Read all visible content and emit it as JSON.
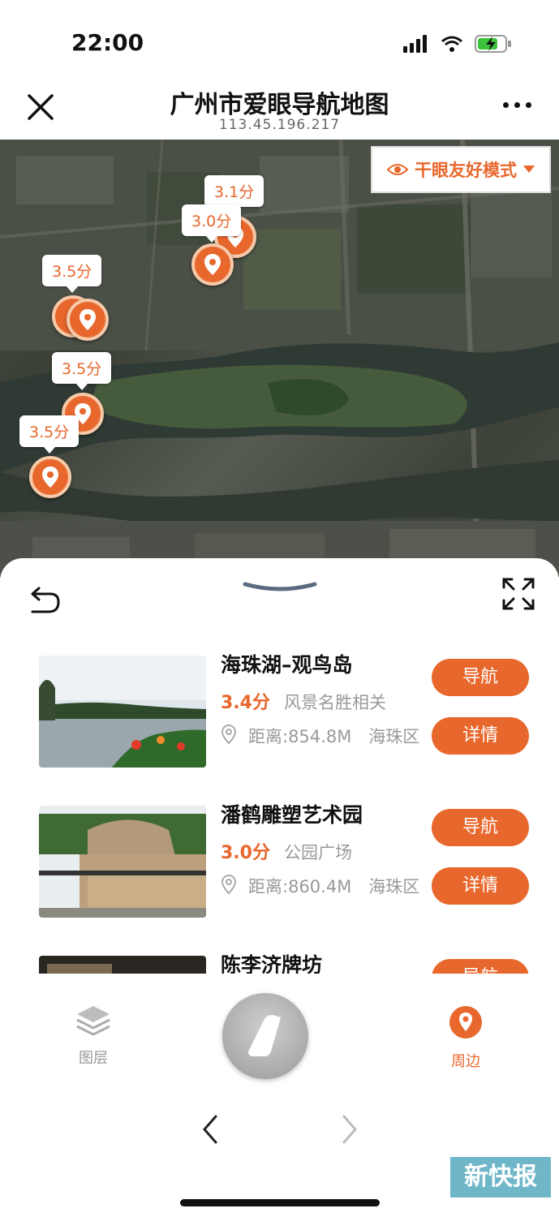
{
  "status_bar": {
    "time": "22:00"
  },
  "nav": {
    "title": "广州市爱眼导航地图",
    "subtitle": "113.45.196.217"
  },
  "map": {
    "mode_toggle_label": "干眼友好模式",
    "pins": [
      {
        "score": "3.1分"
      },
      {
        "score": "3.0分"
      },
      {
        "score": "3.5分"
      },
      {
        "score": "3.5分"
      },
      {
        "score": "3.5分"
      }
    ]
  },
  "poi_list": [
    {
      "name": "海珠湖–观鸟岛",
      "score": "3.4分",
      "category": "风景名胜相关",
      "distance": "距离:854.8M　海珠区",
      "nav_label": "导航",
      "detail_label": "详情"
    },
    {
      "name": "潘鹤雕塑艺术园",
      "score": "3.0分",
      "category": "公园广场",
      "distance": "距离:860.4M　海珠区",
      "nav_label": "导航",
      "detail_label": "详情"
    },
    {
      "name": "陈李济牌坊",
      "nav_label": "导航"
    }
  ],
  "toolbar": {
    "layers_label": "图层",
    "nearby_label": "周边"
  },
  "watermark": "新快报",
  "colors": {
    "accent": "#e8672c",
    "accent_light": "#f6c9a8"
  }
}
